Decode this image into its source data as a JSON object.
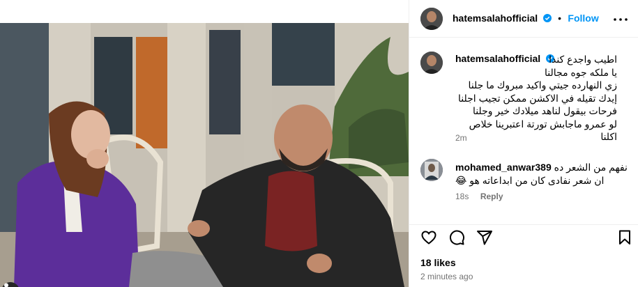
{
  "post": {
    "author": "hatemsalahofficial",
    "follow_label": "Follow",
    "dot": "•",
    "caption_lines": [
      "اطيب واجدع كندا",
      "يا ملكه جوه مجالنا",
      "زي النهارده جيتي واكيد مبروك ما جلنا",
      "إيدك تقيله في الاكشن ممكن تجيب اجلنا",
      "فرحات بيقول لناهد ميلادك خير وجلنا",
      "لو عمرو ماجابش تورتة اعتبرينا خلاص اكلنا"
    ],
    "caption_time": "2m",
    "likes": "18 likes",
    "posted_ago": "2 minutes ago"
  },
  "comments": [
    {
      "user": "mohamed_anwar389",
      "text_line1": "نفهم من الشعر ده",
      "text_line2": "ان شعر نفادى كان من ابداعاته هو 😂",
      "time": "18s",
      "reply_label": "Reply"
    }
  ],
  "icons": {
    "verified": "verified-badge-icon",
    "more": "more-horizontal-icon",
    "like": "heart-icon",
    "comment": "comment-icon",
    "share": "share-icon",
    "save": "bookmark-icon",
    "user_tag": "user-tag-icon"
  },
  "colors": {
    "accent": "#0095f6",
    "muted": "#737373",
    "border": "#efefef"
  }
}
